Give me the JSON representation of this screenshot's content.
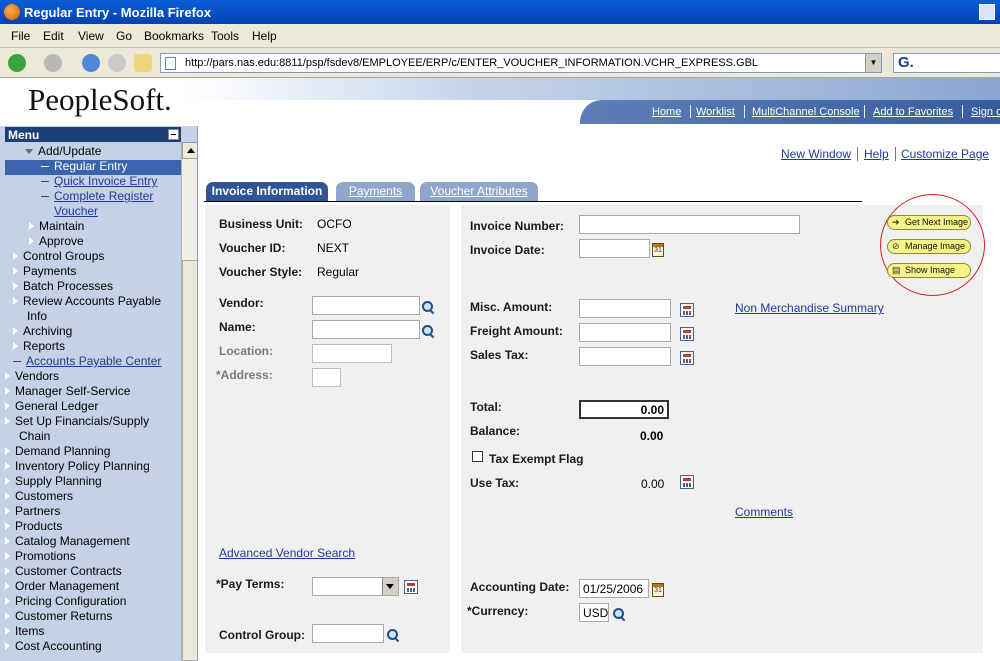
{
  "window": {
    "title": "Regular Entry - Mozilla Firefox"
  },
  "menubar": [
    "File",
    "Edit",
    "View",
    "Go",
    "Bookmarks",
    "Tools",
    "Help"
  ],
  "address": {
    "url": "http://pars.nas.edu:8811/psp/fsdev8/EMPLOYEE/ERP/c/ENTER_VOUCHER_INFORMATION.VCHR_EXPRESS.GBL"
  },
  "search": {
    "glyph": "G."
  },
  "header": {
    "logo": "PeopleSoft.",
    "links": [
      "Home",
      "Worklist",
      "MultiChannel Console",
      "Add to Favorites",
      "Sign out"
    ]
  },
  "sidebar": {
    "title": "Menu",
    "items": [
      {
        "label": "Add/Update",
        "type": "open"
      },
      {
        "label": "Regular Entry",
        "type": "leaf-selected"
      },
      {
        "label": "Quick Invoice Entry",
        "type": "leaf-link"
      },
      {
        "label": "Complete Register",
        "type": "leaf-link"
      },
      {
        "label": "Voucher",
        "type": "cont-link"
      },
      {
        "label": "Maintain",
        "type": "folder"
      },
      {
        "label": "Approve",
        "type": "folder"
      },
      {
        "label": "Control Groups",
        "type": "folder"
      },
      {
        "label": "Payments",
        "type": "folder"
      },
      {
        "label": "Batch Processes",
        "type": "folder"
      },
      {
        "label": "Review Accounts Payable",
        "type": "folder"
      },
      {
        "label": "Info",
        "type": "cont"
      },
      {
        "label": "Archiving",
        "type": "folder"
      },
      {
        "label": "Reports",
        "type": "folder"
      },
      {
        "label": "Accounts Payable Center",
        "type": "leaf-link"
      },
      {
        "label": "Vendors",
        "type": "folder"
      },
      {
        "label": "Manager Self-Service",
        "type": "folder"
      },
      {
        "label": "General Ledger",
        "type": "folder"
      },
      {
        "label": "Set Up Financials/Supply",
        "type": "folder"
      },
      {
        "label": "Chain",
        "type": "cont"
      },
      {
        "label": "Demand Planning",
        "type": "folder"
      },
      {
        "label": "Inventory Policy Planning",
        "type": "folder"
      },
      {
        "label": "Supply Planning",
        "type": "folder"
      },
      {
        "label": "Customers",
        "type": "folder"
      },
      {
        "label": "Partners",
        "type": "folder"
      },
      {
        "label": "Products",
        "type": "folder"
      },
      {
        "label": "Catalog Management",
        "type": "folder"
      },
      {
        "label": "Promotions",
        "type": "folder"
      },
      {
        "label": "Customer Contracts",
        "type": "folder"
      },
      {
        "label": "Order Management",
        "type": "folder"
      },
      {
        "label": "Pricing Configuration",
        "type": "folder"
      },
      {
        "label": "Customer Returns",
        "type": "folder"
      },
      {
        "label": "Items",
        "type": "folder"
      },
      {
        "label": "Cost Accounting",
        "type": "folder"
      }
    ]
  },
  "toplinks": [
    "New Window",
    "Help",
    "Customize Page"
  ],
  "tabs": [
    "Invoice Information",
    "Payments",
    "Voucher Attributes"
  ],
  "left": {
    "business_unit_label": "Business Unit:",
    "business_unit": "OCFO",
    "voucher_id_label": "Voucher ID:",
    "voucher_id": "NEXT",
    "voucher_style_label": "Voucher Style:",
    "voucher_style": "Regular",
    "vendor_label": "Vendor:",
    "vendor": "",
    "name_label": "Name:",
    "name": "",
    "location_label": "Location:",
    "location": "",
    "address_label": "*Address:",
    "address": "",
    "adv_search": "Advanced Vendor Search",
    "pay_terms_label": "*Pay Terms:",
    "pay_terms": "",
    "control_group_label": "Control Group:",
    "control_group": ""
  },
  "right": {
    "invoice_number_label": "Invoice Number:",
    "invoice_number": "",
    "invoice_date_label": "Invoice Date:",
    "invoice_date": "",
    "misc_amount_label": "Misc. Amount:",
    "misc_amount": "",
    "freight_amount_label": "Freight Amount:",
    "freight_amount": "",
    "sales_tax_label": "Sales Tax:",
    "sales_tax": "",
    "non_merch": "Non Merchandise Summary",
    "total_label": "Total:",
    "total": "0.00",
    "balance_label": "Balance:",
    "balance": "0.00",
    "tax_exempt_label": "Tax Exempt Flag",
    "use_tax_label": "Use Tax:",
    "use_tax": "0.00",
    "comments": "Comments",
    "accounting_date_label": "Accounting Date:",
    "accounting_date": "01/25/2006",
    "currency_label": "*Currency:",
    "currency": "USD"
  },
  "image_buttons": [
    "Get Next Image",
    "Manage Image",
    "Show Image"
  ],
  "colors": {
    "tab_active": "#2f5596",
    "tab_inactive": "#8fa6cc",
    "menu_head": "#1d3f78",
    "annotation": "#d81f1f"
  }
}
